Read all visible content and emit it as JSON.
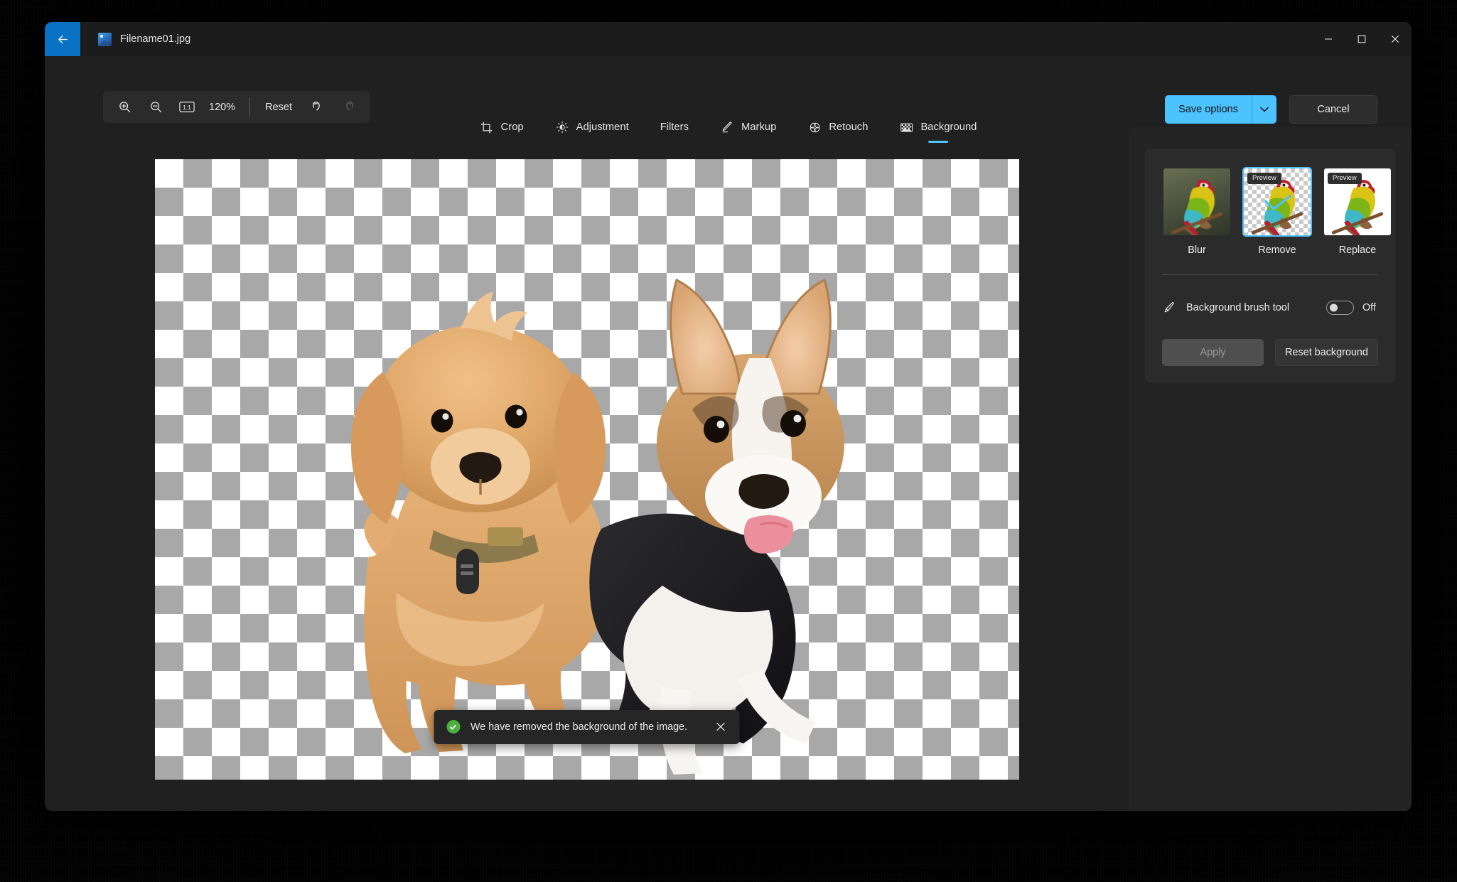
{
  "window": {
    "title": "Filename01.jpg",
    "back_icon": "back-arrow-icon",
    "app_icon": "image-file-icon",
    "minimize_label": "Minimize",
    "maximize_label": "Maximize",
    "close_label": "Close"
  },
  "toolbar": {
    "zoom_in_icon": "zoom-in-icon",
    "zoom_out_icon": "zoom-out-icon",
    "actual_size_icon": "one-to-one-icon",
    "actual_size_text": "1:1",
    "zoom_level": "120%",
    "reset_label": "Reset",
    "undo_icon": "undo-icon",
    "redo_icon": "redo-icon",
    "undo_enabled": true,
    "redo_enabled": false
  },
  "tabs": [
    {
      "label": "Crop",
      "icon": "crop-icon",
      "active": false
    },
    {
      "label": "Adjustment",
      "icon": "brightness-icon",
      "active": false
    },
    {
      "label": "Filters",
      "icon": "none",
      "active": false
    },
    {
      "label": "Markup",
      "icon": "pen-icon",
      "active": false
    },
    {
      "label": "Retouch",
      "icon": "retouch-icon",
      "active": false
    },
    {
      "label": "Background",
      "icon": "background-icon",
      "active": true
    }
  ],
  "actions": {
    "save_label": "Save options",
    "save_chevron_icon": "chevron-down-icon",
    "cancel_label": "Cancel"
  },
  "toast": {
    "message": "We have removed the background of the image.",
    "status_icon": "success-check-icon",
    "close_icon": "close-icon"
  },
  "panel": {
    "options": [
      {
        "label": "Blur",
        "badge": "",
        "selected": false,
        "style": "blur"
      },
      {
        "label": "Remove",
        "badge": "Preview",
        "selected": true,
        "style": "checker"
      },
      {
        "label": "Replace",
        "badge": "Preview",
        "selected": false,
        "style": "white"
      }
    ],
    "brush": {
      "icon": "brush-icon",
      "label": "Background brush tool",
      "toggle_state": "Off",
      "toggle_on": false
    },
    "apply_label": "Apply",
    "apply_enabled": false,
    "reset_label": "Reset background"
  },
  "colors": {
    "accent": "#4cc2ff",
    "back_button": "#0a72c4",
    "window_bg": "#202020",
    "panel_bg": "#242424",
    "card_bg": "#2b2b2b",
    "success": "#4caf3f"
  }
}
